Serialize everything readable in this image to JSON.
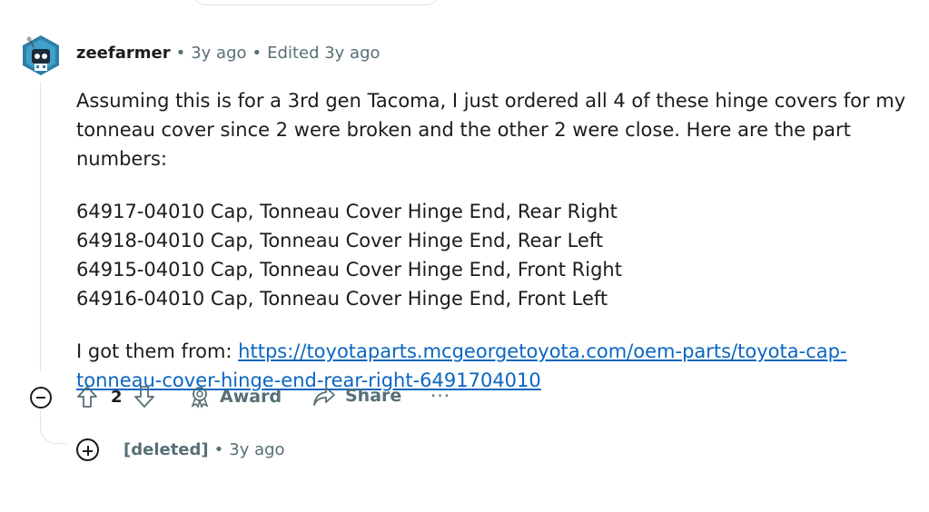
{
  "comment": {
    "username": "zeefarmer",
    "age": "3y ago",
    "edited": "Edited 3y ago",
    "paragraph1": "Assuming this is for a 3rd gen Tacoma, I just ordered all 4 of these hinge covers for my tonneau cover since 2 were broken and the other 2 were close. Here are the part numbers:",
    "parts": [
      "64917-04010 Cap, Tonneau Cover Hinge End, Rear Right",
      "64918-04010 Cap, Tonneau Cover Hinge End, Rear Left",
      "64915-04010 Cap, Tonneau Cover Hinge End, Front Right",
      "64916-04010 Cap, Tonneau Cover Hinge End, Front Left"
    ],
    "link_prefix": "I got them from: ",
    "link_text": "https://toyotaparts.mcgeorgetoyota.com/oem-parts/toyota-cap-tonneau-cover-hinge-end-rear-right-6491704010"
  },
  "actions": {
    "vote_count": "2",
    "award_label": "Award",
    "share_label": "Share",
    "more_label": "···"
  },
  "reply": {
    "author": "[deleted]",
    "age": "3y ago"
  },
  "colors": {
    "link": "#0a66c2",
    "meta": "#576f76",
    "avatar_bg": "#2e7fa8"
  }
}
